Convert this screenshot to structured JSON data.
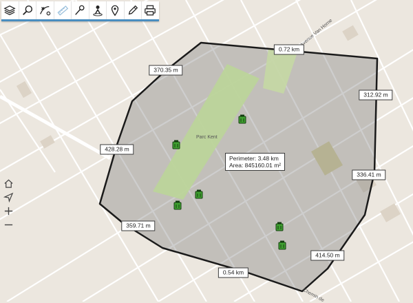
{
  "toolbar": {
    "tools": [
      {
        "name": "layers",
        "icon": "layers-icon"
      },
      {
        "name": "search",
        "icon": "search-icon"
      },
      {
        "name": "route",
        "icon": "route-icon"
      },
      {
        "name": "measure",
        "icon": "measure-icon",
        "active": true
      },
      {
        "name": "pin",
        "icon": "pin-tool-icon"
      },
      {
        "name": "person",
        "icon": "person-icon"
      },
      {
        "name": "location",
        "icon": "location-pin-icon"
      },
      {
        "name": "draw",
        "icon": "pencil-icon"
      },
      {
        "name": "print",
        "icon": "printer-icon"
      }
    ]
  },
  "side_controls": {
    "items": [
      {
        "name": "home",
        "icon": "home-icon"
      },
      {
        "name": "locate",
        "icon": "locate-arrow-icon"
      },
      {
        "name": "zoom_in",
        "icon": "plus-icon"
      },
      {
        "name": "zoom_out",
        "icon": "minus-icon"
      }
    ]
  },
  "map": {
    "park_label": "Parc Kent",
    "street_labels": {
      "avenue": "Avenue Van Horne",
      "chemin": "Chemin de"
    }
  },
  "measurements": {
    "segments": [
      "0.72 km",
      "312.92 m",
      "336.41 m",
      "414.50 m",
      "0.54 km",
      "359.71 m",
      "428.28 m",
      "370.35 m"
    ],
    "perimeter_text": "Perimeter: 3.48 km",
    "area_text": "Area: 845160.01 m²"
  },
  "colors": {
    "polygon_fill": "#7f7f7f",
    "polygon_stroke": "#1a1a1a",
    "park": "#bcd49a",
    "marker": "#3fa030",
    "toolbar_accent": "#4a8ec0"
  }
}
